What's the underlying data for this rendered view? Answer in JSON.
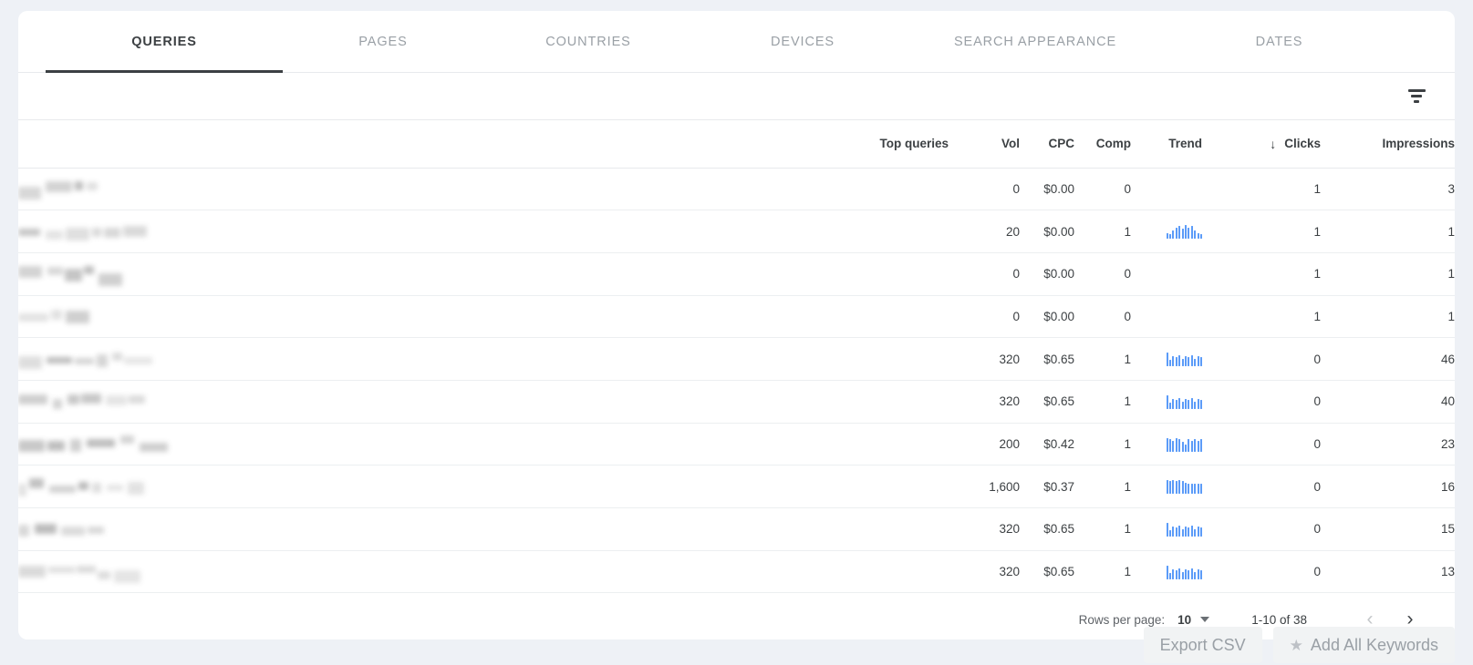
{
  "tabs": [
    {
      "label": "QUERIES",
      "active": true
    },
    {
      "label": "PAGES",
      "active": false
    },
    {
      "label": "COUNTRIES",
      "active": false
    },
    {
      "label": "DEVICES",
      "active": false
    },
    {
      "label": "SEARCH APPEARANCE",
      "active": false
    },
    {
      "label": "DATES",
      "active": false
    }
  ],
  "toolbar": {
    "filter_icon": "filter-icon"
  },
  "table": {
    "headers": {
      "query": "Top queries",
      "vol": "Vol",
      "cpc": "CPC",
      "comp": "Comp",
      "trend": "Trend",
      "clicks": "Clicks",
      "impressions": "Impressions",
      "sort_arrow": "↓",
      "sorted_column": "Clicks"
    },
    "rows": [
      {
        "query": "",
        "vol": "0",
        "cpc": "$0.00",
        "comp": "0",
        "trend": [],
        "clicks": "1",
        "impressions": "3"
      },
      {
        "query": "",
        "vol": "20",
        "cpc": "$0.00",
        "comp": "1",
        "trend": [
          4,
          3,
          6,
          8,
          9,
          7,
          10,
          8,
          9,
          6,
          4,
          3
        ],
        "clicks": "1",
        "impressions": "1"
      },
      {
        "query": "",
        "vol": "0",
        "cpc": "$0.00",
        "comp": "0",
        "trend": [],
        "clicks": "1",
        "impressions": "1"
      },
      {
        "query": "",
        "vol": "0",
        "cpc": "$0.00",
        "comp": "0",
        "trend": [],
        "clicks": "1",
        "impressions": "1"
      },
      {
        "query": "",
        "vol": "320",
        "cpc": "$0.65",
        "comp": "1",
        "trend": [
          11,
          5,
          8,
          7,
          9,
          6,
          8,
          7,
          9,
          6,
          8,
          7
        ],
        "clicks": "0",
        "impressions": "46"
      },
      {
        "query": "",
        "vol": "320",
        "cpc": "$0.65",
        "comp": "1",
        "trend": [
          11,
          5,
          8,
          7,
          9,
          6,
          8,
          7,
          9,
          6,
          8,
          7
        ],
        "clicks": "0",
        "impressions": "40"
      },
      {
        "query": "",
        "vol": "200",
        "cpc": "$0.42",
        "comp": "1",
        "trend": [
          10,
          9,
          8,
          10,
          9,
          7,
          5,
          9,
          8,
          9,
          8,
          9
        ],
        "clicks": "0",
        "impressions": "23"
      },
      {
        "query": "",
        "vol": "1,600",
        "cpc": "$0.37",
        "comp": "1",
        "trend": [
          11,
          10,
          11,
          10,
          11,
          10,
          9,
          8,
          8,
          8,
          8,
          8
        ],
        "clicks": "0",
        "impressions": "16"
      },
      {
        "query": "",
        "vol": "320",
        "cpc": "$0.65",
        "comp": "1",
        "trend": [
          11,
          5,
          8,
          7,
          9,
          6,
          8,
          7,
          9,
          6,
          8,
          7
        ],
        "clicks": "0",
        "impressions": "15"
      },
      {
        "query": "",
        "vol": "320",
        "cpc": "$0.65",
        "comp": "1",
        "trend": [
          11,
          5,
          8,
          7,
          9,
          6,
          8,
          7,
          9,
          6,
          8,
          7
        ],
        "clicks": "0",
        "impressions": "13"
      }
    ]
  },
  "pagination": {
    "rows_per_page_label": "Rows per page:",
    "rows_per_page_value": "10",
    "range": "1-10 of 38",
    "prev_label": "‹",
    "next_label": "›"
  },
  "actions": {
    "export_csv": "Export CSV",
    "add_all_keywords": "Add All Keywords",
    "star_icon": "★"
  },
  "colors": {
    "page_bg": "#eef1f6",
    "card_bg": "#ffffff",
    "text": "#3c4043",
    "muted": "#9aa0a6",
    "clicks_link": "#4285f4",
    "impressions_link": "#8430ce",
    "sparkline": "#5b9bf8",
    "active_tab_underline": "#3c4043"
  }
}
